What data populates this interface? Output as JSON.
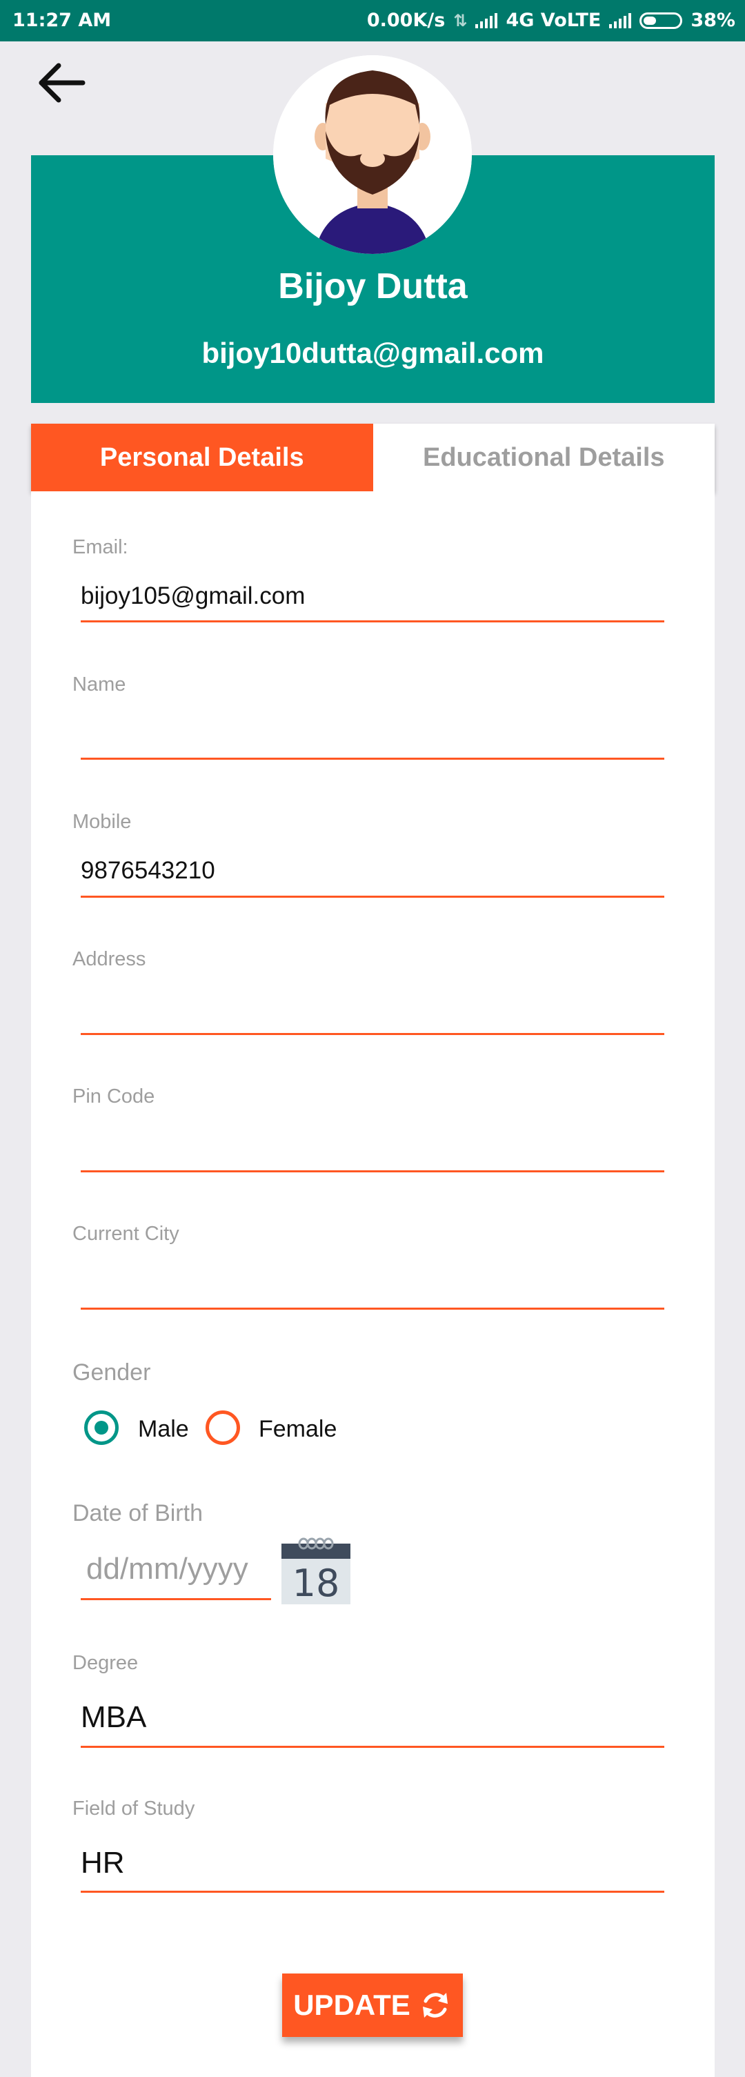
{
  "status_bar": {
    "time": "11:27 AM",
    "speed": "0.00K/s",
    "network": "4G VoLTE",
    "battery": "38%"
  },
  "profile": {
    "name": "Bijoy Dutta",
    "email": "bijoy10dutta@gmail.com"
  },
  "tabs": [
    {
      "label": "Personal Details",
      "active": true
    },
    {
      "label": "Educational Details",
      "active": false
    }
  ],
  "form": {
    "email": {
      "label": "Email:",
      "value": "bijoy105@gmail.com"
    },
    "name": {
      "label": "Name",
      "value": ""
    },
    "mobile": {
      "label": "Mobile",
      "value": "9876543210"
    },
    "address": {
      "label": "Address",
      "value": ""
    },
    "pin_code": {
      "label": "Pin Code",
      "value": ""
    },
    "current_city": {
      "label": "Current City",
      "value": ""
    },
    "gender": {
      "label": "Gender",
      "options": [
        {
          "label": "Male",
          "selected": true
        },
        {
          "label": "Female",
          "selected": false
        }
      ]
    },
    "dob": {
      "label": "Date of Birth",
      "placeholder": "dd/mm/yyyy",
      "calendar_day": "18"
    },
    "degree": {
      "label": "Degree",
      "value": "MBA"
    },
    "field_of_study": {
      "label": "Field of Study",
      "value": "HR"
    }
  },
  "update_button": {
    "label": "UPDATE"
  },
  "colors": {
    "status_bar": "#00796b",
    "header": "#009688",
    "accent": "#ff5722",
    "radio_selected": "#009688"
  }
}
